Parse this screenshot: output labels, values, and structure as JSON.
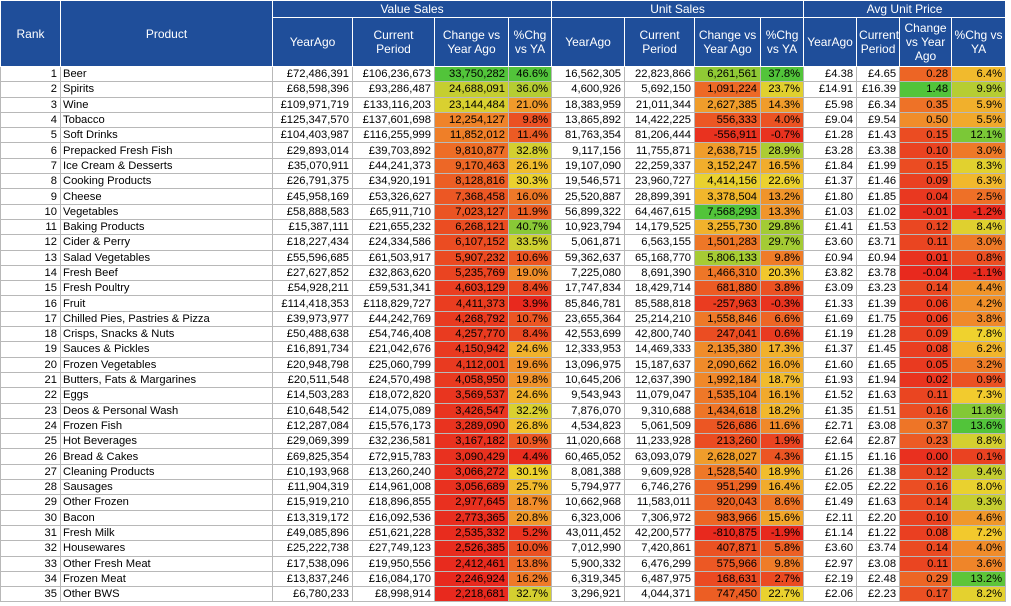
{
  "headers": {
    "rank": "Rank",
    "product": "Product",
    "groups": [
      "Value Sales",
      "Unit Sales",
      "Avg Unit Price"
    ],
    "value_cols": [
      "YearAgo",
      "Current Period",
      "Change vs Year Ago",
      "%Chg vs YA"
    ],
    "unit_cols": [
      "YearAgo",
      "Current Period",
      "Change vs Year Ago",
      "%Chg vs YA"
    ],
    "price_cols": [
      "YearAgo",
      "Current Period",
      "Change vs Year Ago",
      "%Chg vs YA"
    ]
  },
  "colors": {
    "header_bg": "#1f4e9a",
    "scale_red": "#e8291e",
    "scale_orange": "#f08c2a",
    "scale_yellow": "#f2d22e",
    "scale_green": "#52c43a"
  },
  "rows": [
    [
      "1",
      "Beer",
      "£72,486,391",
      "£106,236,673",
      "33,750,282",
      "46.6%",
      "16,562,305",
      "22,823,866",
      "6,261,561",
      "37.8%",
      "£4.38",
      "£4.65",
      "0.28",
      "6.4%"
    ],
    [
      "2",
      "Spirits",
      "£68,598,396",
      "£93,286,487",
      "24,688,091",
      "36.0%",
      "4,600,926",
      "5,692,150",
      "1,091,224",
      "23.7%",
      "£14.91",
      "£16.39",
      "1.48",
      "9.9%"
    ],
    [
      "3",
      "Wine",
      "£109,971,719",
      "£133,116,203",
      "23,144,484",
      "21.0%",
      "18,383,959",
      "21,011,344",
      "2,627,385",
      "14.3%",
      "£5.98",
      "£6.34",
      "0.35",
      "5.9%"
    ],
    [
      "4",
      "Tobacco",
      "£125,347,570",
      "£137,601,698",
      "12,254,127",
      "9.8%",
      "13,865,892",
      "14,422,225",
      "556,333",
      "4.0%",
      "£9.04",
      "£9.54",
      "0.50",
      "5.5%"
    ],
    [
      "5",
      "Soft Drinks",
      "£104,403,987",
      "£116,255,999",
      "11,852,012",
      "11.4%",
      "81,763,354",
      "81,206,444",
      "-556,911",
      "-0.7%",
      "£1.28",
      "£1.43",
      "0.15",
      "12.1%"
    ],
    [
      "6",
      "Prepacked Fresh Fish",
      "£29,893,014",
      "£39,703,892",
      "9,810,877",
      "32.8%",
      "9,117,156",
      "11,755,871",
      "2,638,715",
      "28.9%",
      "£3.28",
      "£3.38",
      "0.10",
      "3.0%"
    ],
    [
      "7",
      "Ice Cream & Desserts",
      "£35,070,911",
      "£44,241,373",
      "9,170,463",
      "26.1%",
      "19,107,090",
      "22,259,337",
      "3,152,247",
      "16.5%",
      "£1.84",
      "£1.99",
      "0.15",
      "8.3%"
    ],
    [
      "8",
      "Cooking Products",
      "£26,791,375",
      "£34,920,191",
      "8,128,816",
      "30.3%",
      "19,546,571",
      "23,960,727",
      "4,414,156",
      "22.6%",
      "£1.37",
      "£1.46",
      "0.09",
      "6.3%"
    ],
    [
      "9",
      "Cheese",
      "£45,958,169",
      "£53,326,627",
      "7,368,458",
      "16.0%",
      "25,520,887",
      "28,899,391",
      "3,378,504",
      "13.2%",
      "£1.80",
      "£1.85",
      "0.04",
      "2.5%"
    ],
    [
      "10",
      "Vegetables",
      "£58,888,583",
      "£65,911,710",
      "7,023,127",
      "11.9%",
      "56,899,322",
      "64,467,615",
      "7,568,293",
      "13.3%",
      "£1.03",
      "£1.02",
      "-0.01",
      "-1.2%"
    ],
    [
      "11",
      "Baking Products",
      "£15,387,111",
      "£21,655,232",
      "6,268,121",
      "40.7%",
      "10,923,794",
      "14,179,525",
      "3,255,730",
      "29.8%",
      "£1.41",
      "£1.53",
      "0.12",
      "8.4%"
    ],
    [
      "12",
      "Cider & Perry",
      "£18,227,434",
      "£24,334,586",
      "6,107,152",
      "33.5%",
      "5,061,871",
      "6,563,155",
      "1,501,283",
      "29.7%",
      "£3.60",
      "£3.71",
      "0.11",
      "3.0%"
    ],
    [
      "13",
      "Salad Vegetables",
      "£55,596,685",
      "£61,503,917",
      "5,907,232",
      "10.6%",
      "59,362,637",
      "65,168,770",
      "5,806,133",
      "9.8%",
      "£0.94",
      "£0.94",
      "0.01",
      "0.8%"
    ],
    [
      "14",
      "Fresh Beef",
      "£27,627,852",
      "£32,863,620",
      "5,235,769",
      "19.0%",
      "7,225,080",
      "8,691,390",
      "1,466,310",
      "20.3%",
      "£3.82",
      "£3.78",
      "-0.04",
      "-1.1%"
    ],
    [
      "15",
      "Fresh Poultry",
      "£54,928,211",
      "£59,531,341",
      "4,603,129",
      "8.4%",
      "17,747,834",
      "18,429,714",
      "681,880",
      "3.8%",
      "£3.09",
      "£3.23",
      "0.14",
      "4.4%"
    ],
    [
      "16",
      "Fruit",
      "£114,418,353",
      "£118,829,727",
      "4,411,373",
      "3.9%",
      "85,846,781",
      "85,588,818",
      "-257,963",
      "-0.3%",
      "£1.33",
      "£1.39",
      "0.06",
      "4.2%"
    ],
    [
      "17",
      "Chilled Pies, Pastries & Pizza",
      "£39,973,977",
      "£44,242,769",
      "4,268,792",
      "10.7%",
      "23,655,364",
      "25,214,210",
      "1,558,846",
      "6.6%",
      "£1.69",
      "£1.75",
      "0.06",
      "3.8%"
    ],
    [
      "18",
      "Crisps, Snacks & Nuts",
      "£50,488,638",
      "£54,746,408",
      "4,257,770",
      "8.4%",
      "42,553,699",
      "42,800,740",
      "247,041",
      "0.6%",
      "£1.19",
      "£1.28",
      "0.09",
      "7.8%"
    ],
    [
      "19",
      "Sauces & Pickles",
      "£16,891,734",
      "£21,042,676",
      "4,150,942",
      "24.6%",
      "12,333,953",
      "14,469,333",
      "2,135,380",
      "17.3%",
      "£1.37",
      "£1.45",
      "0.08",
      "6.2%"
    ],
    [
      "20",
      "Frozen Vegetables",
      "£20,948,798",
      "£25,060,799",
      "4,112,001",
      "19.6%",
      "13,096,975",
      "15,187,637",
      "2,090,662",
      "16.0%",
      "£1.60",
      "£1.65",
      "0.05",
      "3.2%"
    ],
    [
      "21",
      "Butters, Fats & Margarines",
      "£20,511,548",
      "£24,570,498",
      "4,058,950",
      "19.8%",
      "10,645,206",
      "12,637,390",
      "1,992,184",
      "18.7%",
      "£1.93",
      "£1.94",
      "0.02",
      "0.9%"
    ],
    [
      "22",
      "Eggs",
      "£14,503,283",
      "£18,072,820",
      "3,569,537",
      "24.6%",
      "9,543,943",
      "11,079,047",
      "1,535,104",
      "16.1%",
      "£1.52",
      "£1.63",
      "0.11",
      "7.3%"
    ],
    [
      "23",
      "Deos & Personal Wash",
      "£10,648,542",
      "£14,075,089",
      "3,426,547",
      "32.2%",
      "7,876,070",
      "9,310,688",
      "1,434,618",
      "18.2%",
      "£1.35",
      "£1.51",
      "0.16",
      "11.8%"
    ],
    [
      "24",
      "Frozen Fish",
      "£12,287,084",
      "£15,576,173",
      "3,289,090",
      "26.8%",
      "4,534,823",
      "5,061,509",
      "526,686",
      "11.6%",
      "£2.71",
      "£3.08",
      "0.37",
      "13.6%"
    ],
    [
      "25",
      "Hot Beverages",
      "£29,069,399",
      "£32,236,581",
      "3,167,182",
      "10.9%",
      "11,020,668",
      "11,233,928",
      "213,260",
      "1.9%",
      "£2.64",
      "£2.87",
      "0.23",
      "8.8%"
    ],
    [
      "26",
      "Bread & Cakes",
      "£69,825,354",
      "£72,915,783",
      "3,090,429",
      "4.4%",
      "60,465,052",
      "63,093,079",
      "2,628,027",
      "4.3%",
      "£1.15",
      "£1.16",
      "0.00",
      "0.1%"
    ],
    [
      "27",
      "Cleaning Products",
      "£10,193,968",
      "£13,260,240",
      "3,066,272",
      "30.1%",
      "8,081,388",
      "9,609,928",
      "1,528,540",
      "18.9%",
      "£1.26",
      "£1.38",
      "0.12",
      "9.4%"
    ],
    [
      "28",
      "Sausages",
      "£11,904,319",
      "£14,961,008",
      "3,056,689",
      "25.7%",
      "5,794,977",
      "6,746,276",
      "951,299",
      "16.4%",
      "£2.05",
      "£2.22",
      "0.16",
      "8.0%"
    ],
    [
      "29",
      "Other Frozen",
      "£15,919,210",
      "£18,896,855",
      "2,977,645",
      "18.7%",
      "10,662,968",
      "11,583,011",
      "920,043",
      "8.6%",
      "£1.49",
      "£1.63",
      "0.14",
      "9.3%"
    ],
    [
      "30",
      "Bacon",
      "£13,319,172",
      "£16,092,536",
      "2,773,365",
      "20.8%",
      "6,323,006",
      "7,306,972",
      "983,966",
      "15.6%",
      "£2.11",
      "£2.20",
      "0.10",
      "4.6%"
    ],
    [
      "31",
      "Fresh Milk",
      "£49,085,896",
      "£51,621,228",
      "2,535,332",
      "5.2%",
      "43,011,452",
      "42,200,577",
      "-810,875",
      "-1.9%",
      "£1.14",
      "£1.22",
      "0.08",
      "7.2%"
    ],
    [
      "32",
      "Housewares",
      "£25,222,738",
      "£27,749,123",
      "2,526,385",
      "10.0%",
      "7,012,990",
      "7,420,861",
      "407,871",
      "5.8%",
      "£3.60",
      "£3.74",
      "0.14",
      "4.0%"
    ],
    [
      "33",
      "Other Fresh Meat",
      "£17,538,096",
      "£19,950,556",
      "2,412,461",
      "13.8%",
      "5,900,332",
      "6,476,299",
      "575,966",
      "9.8%",
      "£2.97",
      "£3.08",
      "0.11",
      "3.6%"
    ],
    [
      "34",
      "Frozen Meat",
      "£13,837,246",
      "£16,084,170",
      "2,246,924",
      "16.2%",
      "6,319,345",
      "6,487,975",
      "168,631",
      "2.7%",
      "£2.19",
      "£2.48",
      "0.29",
      "13.2%"
    ],
    [
      "35",
      "Other BWS",
      "£6,780,233",
      "£8,998,914",
      "2,218,681",
      "32.7%",
      "3,296,921",
      "4,044,371",
      "747,450",
      "22.7%",
      "£2.06",
      "£2.23",
      "0.17",
      "8.2%"
    ]
  ]
}
